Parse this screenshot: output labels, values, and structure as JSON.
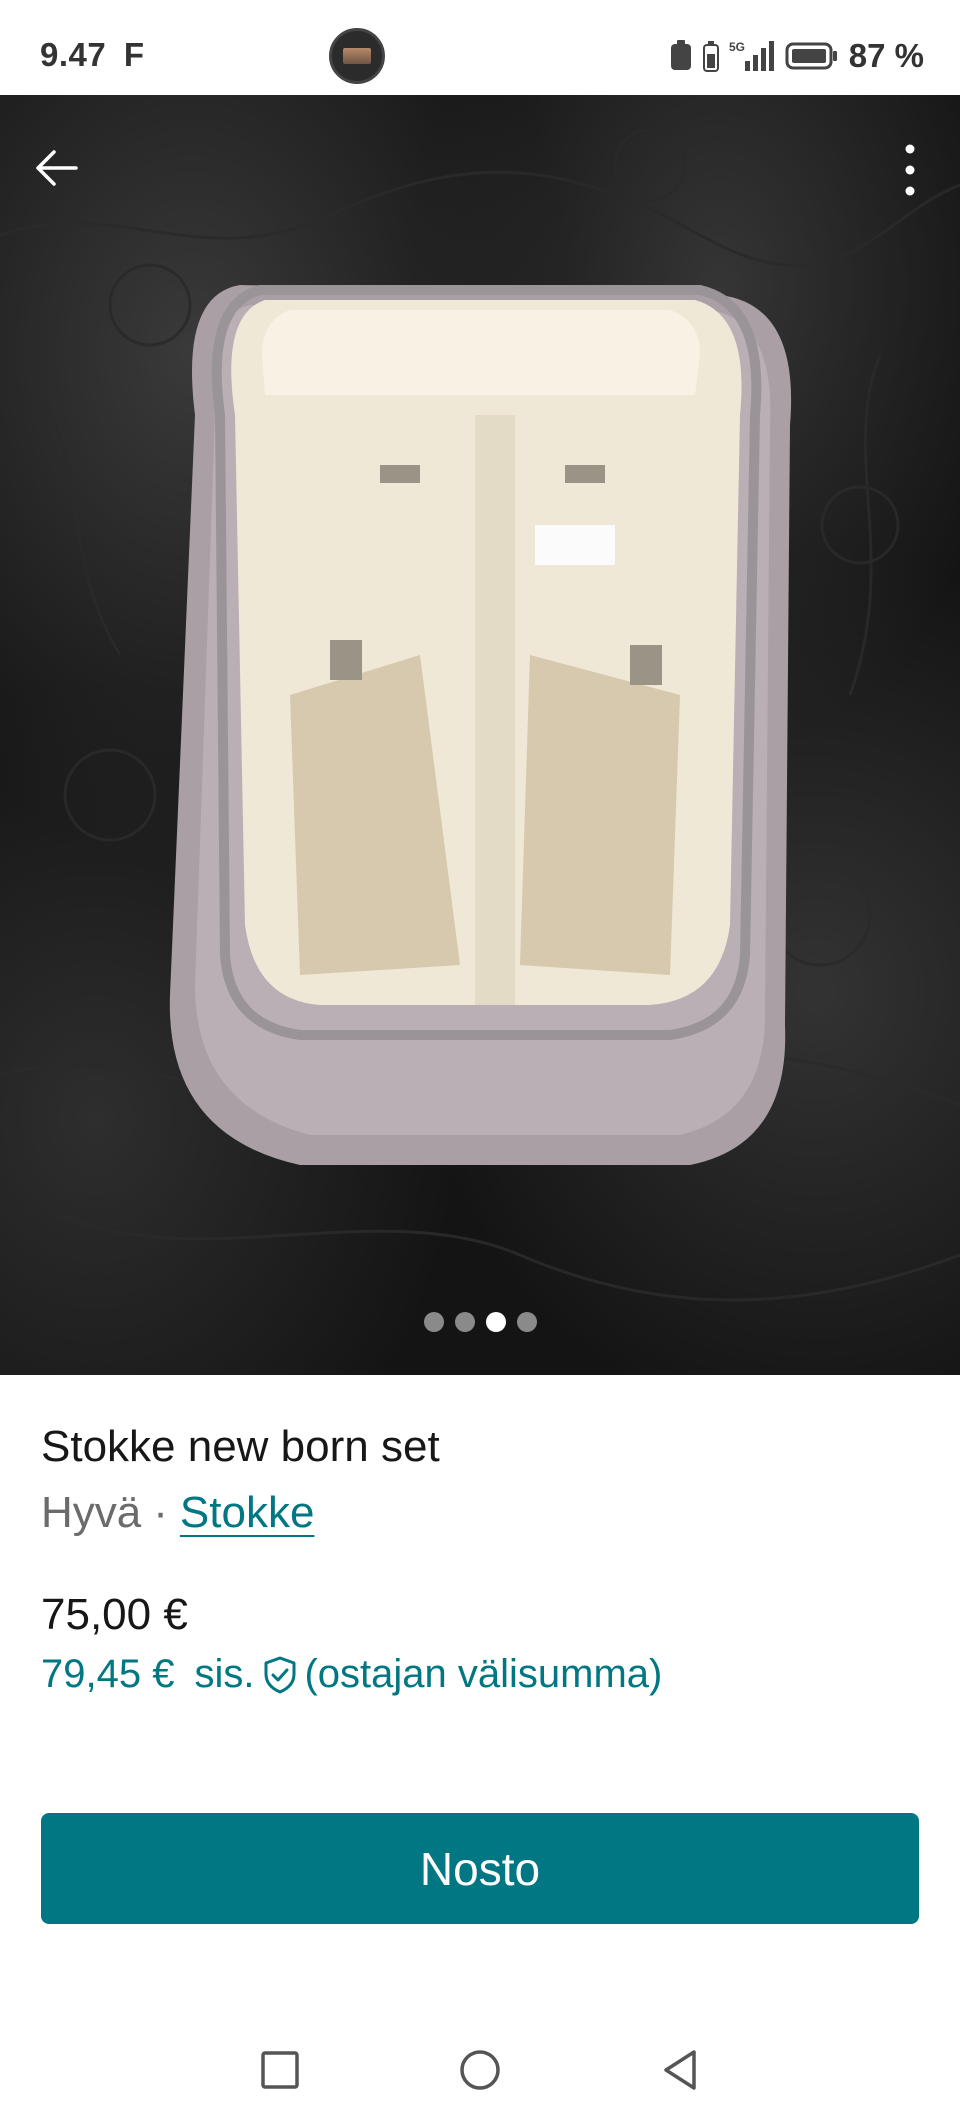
{
  "status_bar": {
    "time": "9.47",
    "notification_letter": "F",
    "network": "5G",
    "battery_percent": "87 %"
  },
  "photo": {
    "page_count": 4,
    "active_index": 2
  },
  "item": {
    "title": "Stokke new born set",
    "condition": "Hyvä",
    "separator": "·",
    "brand": "Stokke",
    "price": "75,00 €",
    "total_price": "79,45 €",
    "total_incl": "sis.",
    "total_note": "(ostajan välisumma)"
  },
  "actions": {
    "buy_label": "Nosto"
  },
  "colors": {
    "accent": "#007782",
    "text": "#171717",
    "muted": "#6b6b6b"
  },
  "icons": {
    "back": "arrow-left-icon",
    "more": "more-vertical-icon",
    "buyer_protection": "shield-check-icon",
    "nav_recents": "square-icon",
    "nav_home": "circle-icon",
    "nav_back": "triangle-back-icon"
  }
}
